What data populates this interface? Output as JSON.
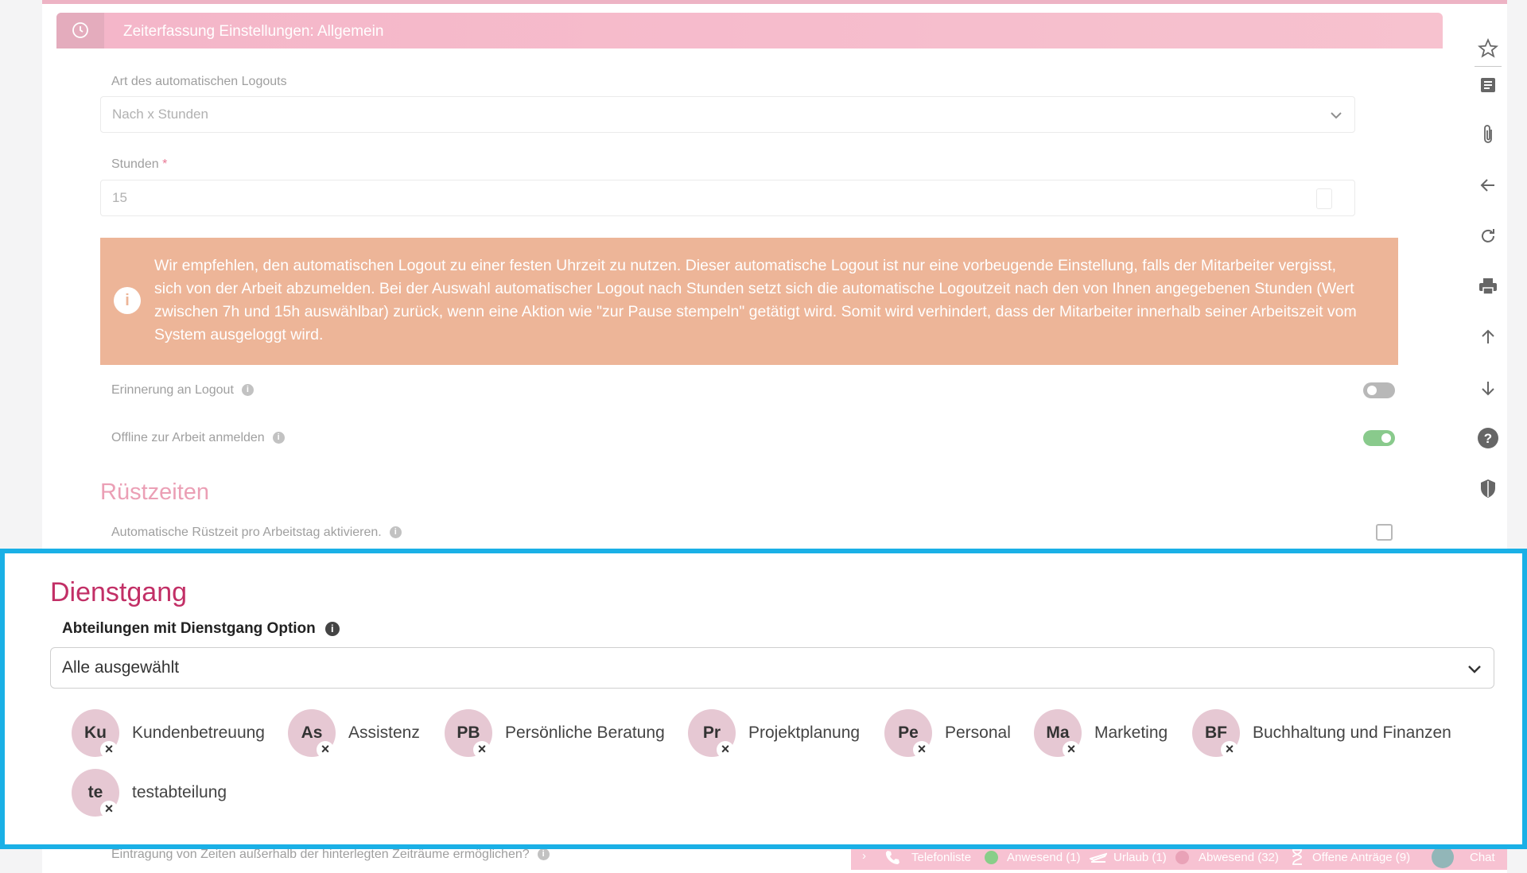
{
  "card": {
    "title": "Zeiterfassung Einstellungen: Allgemein"
  },
  "logout_type": {
    "label": "Art des automatischen Logouts",
    "value": "Nach x Stunden"
  },
  "hours": {
    "label": "Stunden",
    "required_mark": "*",
    "value": "15"
  },
  "warning": {
    "icon": "info-icon",
    "text": "Wir empfehlen, den automatischen Logout zu einer festen Uhrzeit zu nutzen. Dieser automatische Logout ist nur eine vorbeugende Einstellung, falls der Mitarbeiter vergisst, sich von der Arbeit abzumelden. Bei der Auswahl automatischer Logout nach Stunden setzt sich die automatische Logoutzeit nach den von Ihnen angegebenen Stunden (Wert zwischen 7h und 15h auswählbar) zurück, wenn eine Aktion wie \"zur Pause stempeln\" getätigt wird. Somit wird verhindert, dass der Mitarbeiter innerhalb seiner Arbeitszeit vom System ausgeloggt wird."
  },
  "logout_reminder": {
    "label": "Erinnerung an Logout",
    "enabled": false
  },
  "offline_login": {
    "label": "Offline zur Arbeit anmelden",
    "enabled": true
  },
  "setup_times": {
    "heading": "Rüstzeiten",
    "auto_label": "Automatische Rüstzeit pro Arbeitstag aktivieren.",
    "checked": false
  },
  "business_trip": {
    "heading": "Dienstgang",
    "departments_label": "Abteilungen mit Dienstgang Option",
    "selected_value": "Alle ausgewählt",
    "departments": [
      {
        "abbr": "Ku",
        "name": "Kundenbetreuung"
      },
      {
        "abbr": "As",
        "name": "Assistenz"
      },
      {
        "abbr": "PB",
        "name": "Persönliche Beratung"
      },
      {
        "abbr": "Pr",
        "name": "Projektplanung"
      },
      {
        "abbr": "Pe",
        "name": "Personal"
      },
      {
        "abbr": "Ma",
        "name": "Marketing"
      },
      {
        "abbr": "BF",
        "name": "Buchhaltung und Finanzen"
      },
      {
        "abbr": "te",
        "name": "testabteilung"
      }
    ]
  },
  "outside_times": {
    "label": "Eintragung von Zeiten außerhalb der hinterlegten Zeiträume ermöglichen?"
  },
  "statusbar": {
    "phone_list": "Telefonliste",
    "present": "Anwesend (1)",
    "vacation": "Urlaub (1)",
    "absent": "Abwesend (32)",
    "open_requests": "Offene Anträge (9)",
    "chat": "Chat"
  },
  "right_rail": [
    "star-icon",
    "notes-icon",
    "paperclip-icon",
    "arrow-left-icon",
    "refresh-icon",
    "print-icon",
    "arrow-up-icon",
    "arrow-down-icon",
    "help-icon",
    "shield-icon"
  ],
  "colors": {
    "accent": "#c22f66",
    "highlight_border": "#1ab0e6",
    "warning": "#e9a582",
    "header_pink": "#f2a6bd"
  }
}
